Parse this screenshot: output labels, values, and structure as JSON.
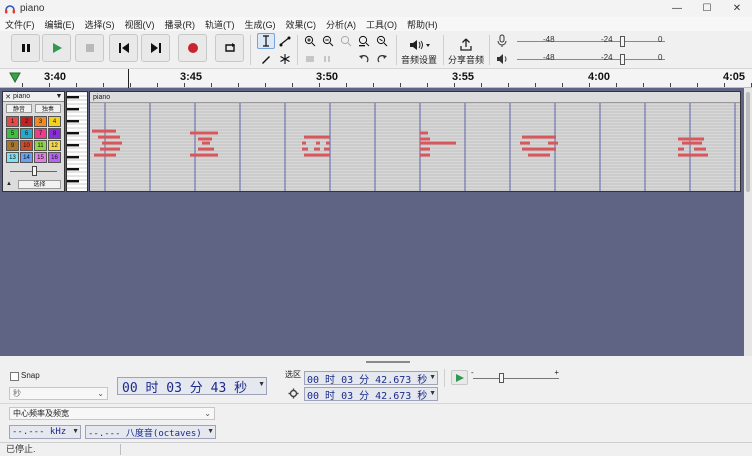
{
  "window": {
    "title": "piano",
    "minimize": "—",
    "maximize": "☐",
    "close": "✕"
  },
  "menu": [
    "文件(F)",
    "编辑(E)",
    "选择(S)",
    "视图(V)",
    "播录(R)",
    "轨道(T)",
    "生成(G)",
    "效果(C)",
    "分析(A)",
    "工具(O)",
    "帮助(H)"
  ],
  "toolbar": {
    "audio_settings_label": "音频设置",
    "share_audio_label": "分享音频",
    "record_meter": {
      "ticks": [
        "-48",
        "-24",
        "0"
      ],
      "level": 0.72
    },
    "playback_meter": {
      "ticks": [
        "-48",
        "-24",
        "0"
      ],
      "level": 0.72
    }
  },
  "ruler": {
    "labels": [
      "3:40",
      "3:45",
      "3:50",
      "3:55",
      "4:00",
      "4:05"
    ]
  },
  "track": {
    "name": "piano",
    "mute_label": "静音",
    "solo_label": "独奏",
    "channels": [
      "1",
      "2",
      "3",
      "4",
      "5",
      "6",
      "7",
      "8",
      "9",
      "10",
      "11",
      "12",
      "13",
      "14",
      "15",
      "16"
    ],
    "select_label": "选择",
    "clip_title": "piano"
  },
  "colors": {
    "workspace": "#5f6384",
    "note": "#d9565b",
    "channel_colors": [
      "#e34b4b",
      "#c32222",
      "#f08a22",
      "#f2d21e",
      "#3fbf3f",
      "#2aa8c9",
      "#ef3d8d",
      "#8a2be2",
      "#a6782f",
      "#d14b2a",
      "#8fd34b",
      "#f0d84a",
      "#7fe0ef",
      "#6aa0f0",
      "#e37fe0",
      "#b565f2"
    ]
  },
  "selection_toolbar": {
    "snap_label": "Snap",
    "snap_unit": "秒",
    "time_value": "00 时 03 分 43 秒",
    "selection_label": "选区",
    "selection_start": "00 时 03 分 42.673 秒",
    "selection_end": "00 时 03 分 42.673 秒",
    "spectral_mode": "中心频率及频宽",
    "freq_value": "--.--- kHz",
    "octave_value": "--.--- 八度音(octaves)"
  },
  "status": {
    "text": "已停止."
  }
}
